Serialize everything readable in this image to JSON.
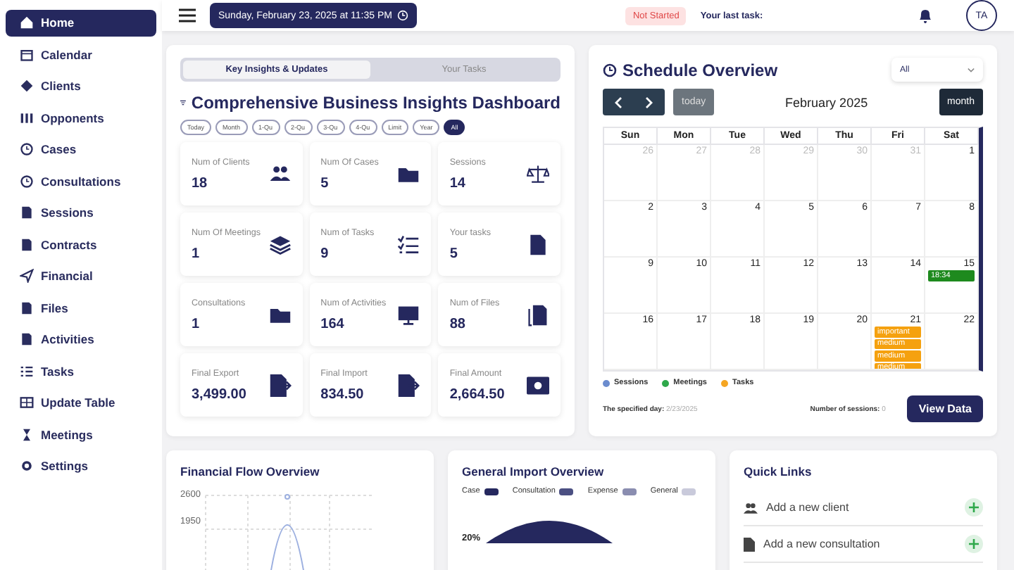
{
  "sidebar": {
    "items": [
      {
        "label": "Home",
        "selected": true
      },
      {
        "label": "Calendar",
        "selected": false
      },
      {
        "label": "Clients",
        "selected": false
      },
      {
        "label": "Opponents",
        "selected": false
      },
      {
        "label": "Cases",
        "selected": false
      },
      {
        "label": "Consultations",
        "selected": false
      },
      {
        "label": "Sessions",
        "selected": false
      },
      {
        "label": "Contracts",
        "selected": false
      },
      {
        "label": "Financial",
        "selected": false
      },
      {
        "label": "Files",
        "selected": false
      },
      {
        "label": "Activities",
        "selected": false
      },
      {
        "label": "Tasks",
        "selected": false
      },
      {
        "label": "Update Table",
        "selected": false
      },
      {
        "label": "Meetings",
        "selected": false
      },
      {
        "label": "Settings",
        "selected": false
      }
    ]
  },
  "header": {
    "datetime": "Sunday, February 23, 2025 at 11:35 PM",
    "status_badge": "Not Started",
    "last_task_label": "Your last task:",
    "avatar": "TA"
  },
  "insights": {
    "tabs": [
      {
        "label": "Key Insights & Updates",
        "selected": true
      },
      {
        "label": "Your Tasks",
        "selected": false
      }
    ],
    "title": "Comprehensive Business Insights Dashboard",
    "filters": [
      {
        "label": "Today",
        "selected": false
      },
      {
        "label": "Month",
        "selected": false
      },
      {
        "label": "1-Qu",
        "selected": false
      },
      {
        "label": "2-Qu",
        "selected": false
      },
      {
        "label": "3-Qu",
        "selected": false
      },
      {
        "label": "4-Qu",
        "selected": false
      },
      {
        "label": "Limit",
        "selected": false
      },
      {
        "label": "Year",
        "selected": false
      },
      {
        "label": "All",
        "selected": true
      }
    ],
    "stats": [
      {
        "label": "Num of Clients",
        "value": "18"
      },
      {
        "label": "Num Of Cases",
        "value": "5"
      },
      {
        "label": "Sessions",
        "value": "14"
      },
      {
        "label": "Num Of Meetings",
        "value": "1"
      },
      {
        "label": "Num of Tasks",
        "value": "9"
      },
      {
        "label": "Your tasks",
        "value": "5"
      },
      {
        "label": "Consultations",
        "value": "1"
      },
      {
        "label": "Num of Activities",
        "value": "164"
      },
      {
        "label": "Num of Files",
        "value": "88"
      },
      {
        "label": "Final Export",
        "value": "3,499.00"
      },
      {
        "label": "Final Import",
        "value": "834.50"
      },
      {
        "label": "Final Amount",
        "value": "2,664.50"
      }
    ]
  },
  "schedule": {
    "title": "Schedule Overview",
    "filter": "All",
    "today_button": "today",
    "month_label": "February 2025",
    "view_button": "month",
    "weekdays": [
      "Sun",
      "Mon",
      "Tue",
      "Wed",
      "Thu",
      "Fri",
      "Sat"
    ],
    "weeks": [
      [
        {
          "day": "26",
          "muted": true
        },
        {
          "day": "27",
          "muted": true
        },
        {
          "day": "28",
          "muted": true
        },
        {
          "day": "29",
          "muted": true
        },
        {
          "day": "30",
          "muted": true
        },
        {
          "day": "31",
          "muted": true
        },
        {
          "day": "1",
          "muted": false
        }
      ],
      [
        {
          "day": "2",
          "muted": false
        },
        {
          "day": "3",
          "muted": false
        },
        {
          "day": "4",
          "muted": false
        },
        {
          "day": "5",
          "muted": false
        },
        {
          "day": "6",
          "muted": false
        },
        {
          "day": "7",
          "muted": false
        },
        {
          "day": "8",
          "muted": false
        }
      ],
      [
        {
          "day": "9",
          "muted": false
        },
        {
          "day": "10",
          "muted": false
        },
        {
          "day": "11",
          "muted": false
        },
        {
          "day": "12",
          "muted": false
        },
        {
          "day": "13",
          "muted": false
        },
        {
          "day": "14",
          "muted": false
        },
        {
          "day": "15",
          "muted": false,
          "events": [
            {
              "label": "18:34",
              "color": "#1e8a1e"
            }
          ]
        }
      ],
      [
        {
          "day": "16",
          "muted": false
        },
        {
          "day": "17",
          "muted": false
        },
        {
          "day": "18",
          "muted": false
        },
        {
          "day": "19",
          "muted": false
        },
        {
          "day": "20",
          "muted": false
        },
        {
          "day": "21",
          "muted": false,
          "events": [
            {
              "label": "important",
              "color": "#f5a10f"
            },
            {
              "label": "medium",
              "color": "#f5a10f"
            },
            {
              "label": "medium",
              "color": "#f5a10f"
            },
            {
              "label": "medium",
              "color": "#f5a10f"
            }
          ]
        },
        {
          "day": "22",
          "muted": false
        }
      ]
    ],
    "legend": [
      {
        "label": "Sessions",
        "color": "#6b8cce"
      },
      {
        "label": "Meetings",
        "color": "#2ea84a"
      },
      {
        "label": "Tasks",
        "color": "#f5a623"
      }
    ],
    "specified_day_label": "The specified day:",
    "specified_day": "2/23/2025",
    "sessions_label": "Number of sessions:",
    "sessions_count": "0",
    "view_data_button": "View Data"
  },
  "financial_flow": {
    "title": "Financial Flow Overview",
    "y_tick_labels": [
      "2600",
      "1950"
    ]
  },
  "general_import": {
    "title": "General Import Overview",
    "legend": [
      {
        "label": "Case",
        "color": "#25285e"
      },
      {
        "label": "Consultation",
        "color": "#4b4f82"
      },
      {
        "label": "Expense",
        "color": "#8a8db0"
      },
      {
        "label": "General",
        "color": "#c9cadb"
      }
    ],
    "slice_label": "20%"
  },
  "quick_links": {
    "title": "Quick Links",
    "links": [
      "Add a new client",
      "Add a new consultation"
    ]
  }
}
